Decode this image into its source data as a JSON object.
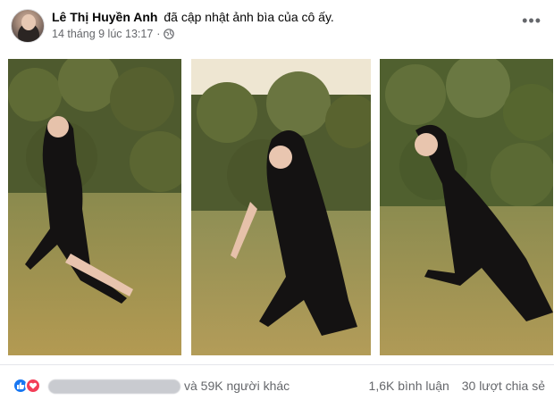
{
  "post": {
    "author": "Lê Thị Huyền Anh",
    "action": "đã cập nhật ảnh bìa của cô ấy.",
    "timestamp": "14 tháng 9 lúc 13:17",
    "separator": "·",
    "privacy_icon": "globe-icon",
    "more_icon": "more-horizontal-icon",
    "more_label": "•••"
  },
  "photos": [
    {
      "description_icon": "photo",
      "palette": "garden"
    },
    {
      "description_icon": "photo",
      "palette": "garden"
    },
    {
      "description_icon": "photo",
      "palette": "garden"
    }
  ],
  "footer": {
    "reaction_icons": [
      "like-icon",
      "love-icon"
    ],
    "reactions_text": "và 59K người khác",
    "comments": "1,6K bình luận",
    "shares": "30 lượt chia sẻ"
  },
  "colors": {
    "like": "#1877f2",
    "love": "#f33e58",
    "secondary_text": "#65676b"
  }
}
